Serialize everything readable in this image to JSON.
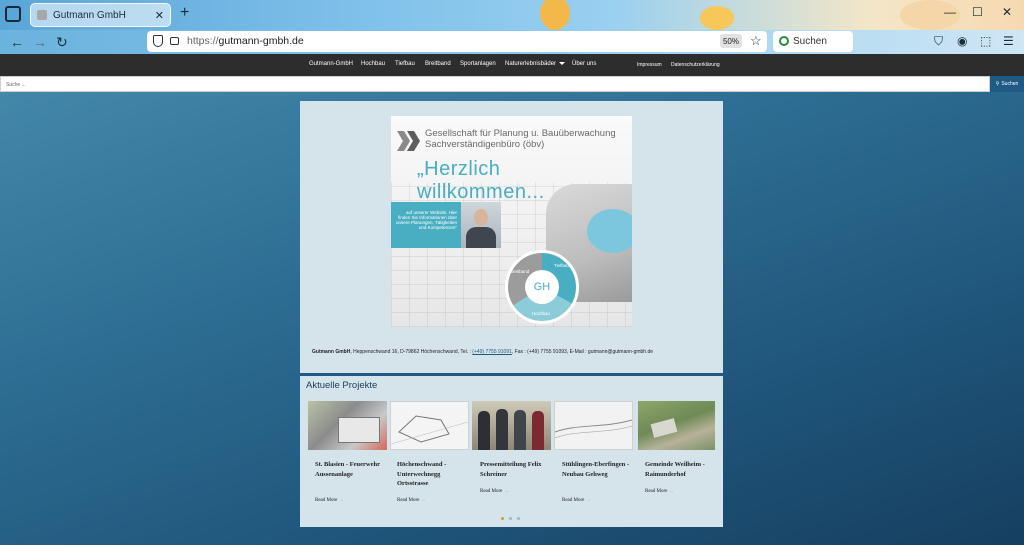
{
  "browser": {
    "tab_title": "Gutmann GmbH",
    "url_protocol": "https://",
    "url_domain": "gutmann-gmbh.de",
    "zoom": "50%",
    "search_placeholder": "Suchen"
  },
  "site_nav": {
    "items": [
      "Gutmann-GmbH",
      "Hochbau",
      "Tiefbau",
      "Breitband",
      "Sportanlagen",
      "Naturerlebnisbäder",
      "Über uns"
    ],
    "right_items": [
      "Impressum",
      "Datenschutzerklärung"
    ]
  },
  "site_search": {
    "placeholder": "Suche ...",
    "button_label": "Suchen"
  },
  "hero": {
    "company_line1": "Gesellschaft für Planung u. Bauüberwachung",
    "company_line2": "Sachverständigenbüro (öbv)",
    "welcome": "„Herzlich willkommen...",
    "info_text": "auf unserer Website. Hier finden Sie Informationen über unsere Planungen, Tätigkeiten und Kompetenzen\"",
    "logo_text": "GH",
    "ring_labels": [
      "Tiefbau",
      "Hochbau",
      "Breitband"
    ]
  },
  "contact": {
    "company": "Gutmann GmbH",
    "address": ", Heppenschwand 16, D-79862 Höchenschwand, Tel. : ",
    "phone": "(+49) 7755 91091",
    "rest": ", Fax : (+49) 7755 91093, E-Mail : gutmann@gutmann-gmbh.de"
  },
  "projects": {
    "heading": "Aktuelle Projekte",
    "read_more": "Read More",
    "items": [
      {
        "title": "St. Blasien - Feuerwehr Aussenanlage"
      },
      {
        "title": "Höchenschwand - Unterwechnegg Ortsstrasse"
      },
      {
        "title": "Pressemitteilung Felix Schreiner"
      },
      {
        "title": "Stühlingen-Eberfingen - Neubau Gehweg"
      },
      {
        "title": "Gemeinde Weilheim - Raimunderhof"
      }
    ]
  }
}
